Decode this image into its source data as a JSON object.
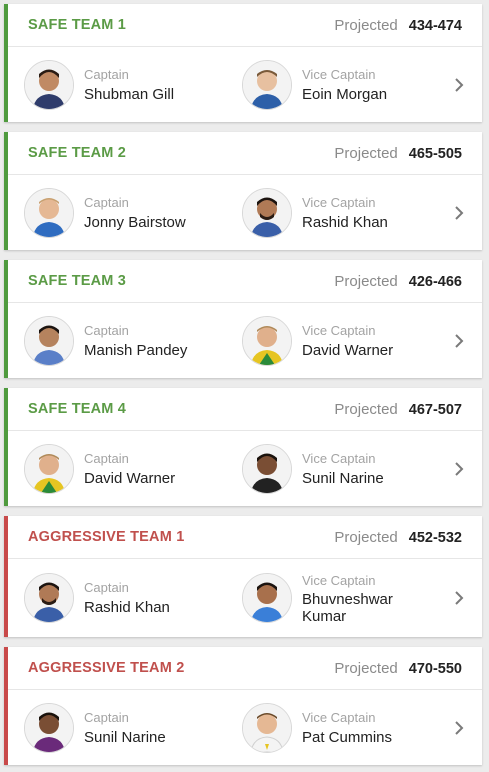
{
  "labels": {
    "projected": "Projected",
    "captain": "Captain",
    "vice_captain": "Vice Captain"
  },
  "colors": {
    "safe_accent": "#4f9a3e",
    "aggressive_accent": "#c84a4a"
  },
  "teams": [
    {
      "name": "SAFE TEAM 1",
      "type": "safe",
      "projected": "434-474",
      "captain": {
        "name": "Shubman Gill",
        "avatar_icon": "player-avatar-icon"
      },
      "vice_captain": {
        "name": "Eoin Morgan",
        "avatar_icon": "player-avatar-icon"
      }
    },
    {
      "name": "SAFE TEAM 2",
      "type": "safe",
      "projected": "465-505",
      "captain": {
        "name": "Jonny Bairstow",
        "avatar_icon": "player-avatar-icon"
      },
      "vice_captain": {
        "name": "Rashid Khan",
        "avatar_icon": "player-avatar-icon"
      }
    },
    {
      "name": "SAFE TEAM 3",
      "type": "safe",
      "projected": "426-466",
      "captain": {
        "name": "Manish Pandey",
        "avatar_icon": "player-avatar-icon"
      },
      "vice_captain": {
        "name": "David Warner",
        "avatar_icon": "player-avatar-icon"
      }
    },
    {
      "name": "SAFE TEAM 4",
      "type": "safe",
      "projected": "467-507",
      "captain": {
        "name": "David Warner",
        "avatar_icon": "player-avatar-icon"
      },
      "vice_captain": {
        "name": "Sunil Narine",
        "avatar_icon": "player-avatar-icon"
      }
    },
    {
      "name": "AGGRESSIVE TEAM 1",
      "type": "aggressive",
      "projected": "452-532",
      "captain": {
        "name": "Rashid Khan",
        "avatar_icon": "player-avatar-icon"
      },
      "vice_captain": {
        "name": "Bhuvneshwar Kumar",
        "avatar_icon": "player-avatar-icon"
      }
    },
    {
      "name": "AGGRESSIVE TEAM 2",
      "type": "aggressive",
      "projected": "470-550",
      "captain": {
        "name": "Sunil Narine",
        "avatar_icon": "player-avatar-icon"
      },
      "vice_captain": {
        "name": "Pat Cummins",
        "avatar_icon": "player-avatar-icon"
      }
    }
  ]
}
